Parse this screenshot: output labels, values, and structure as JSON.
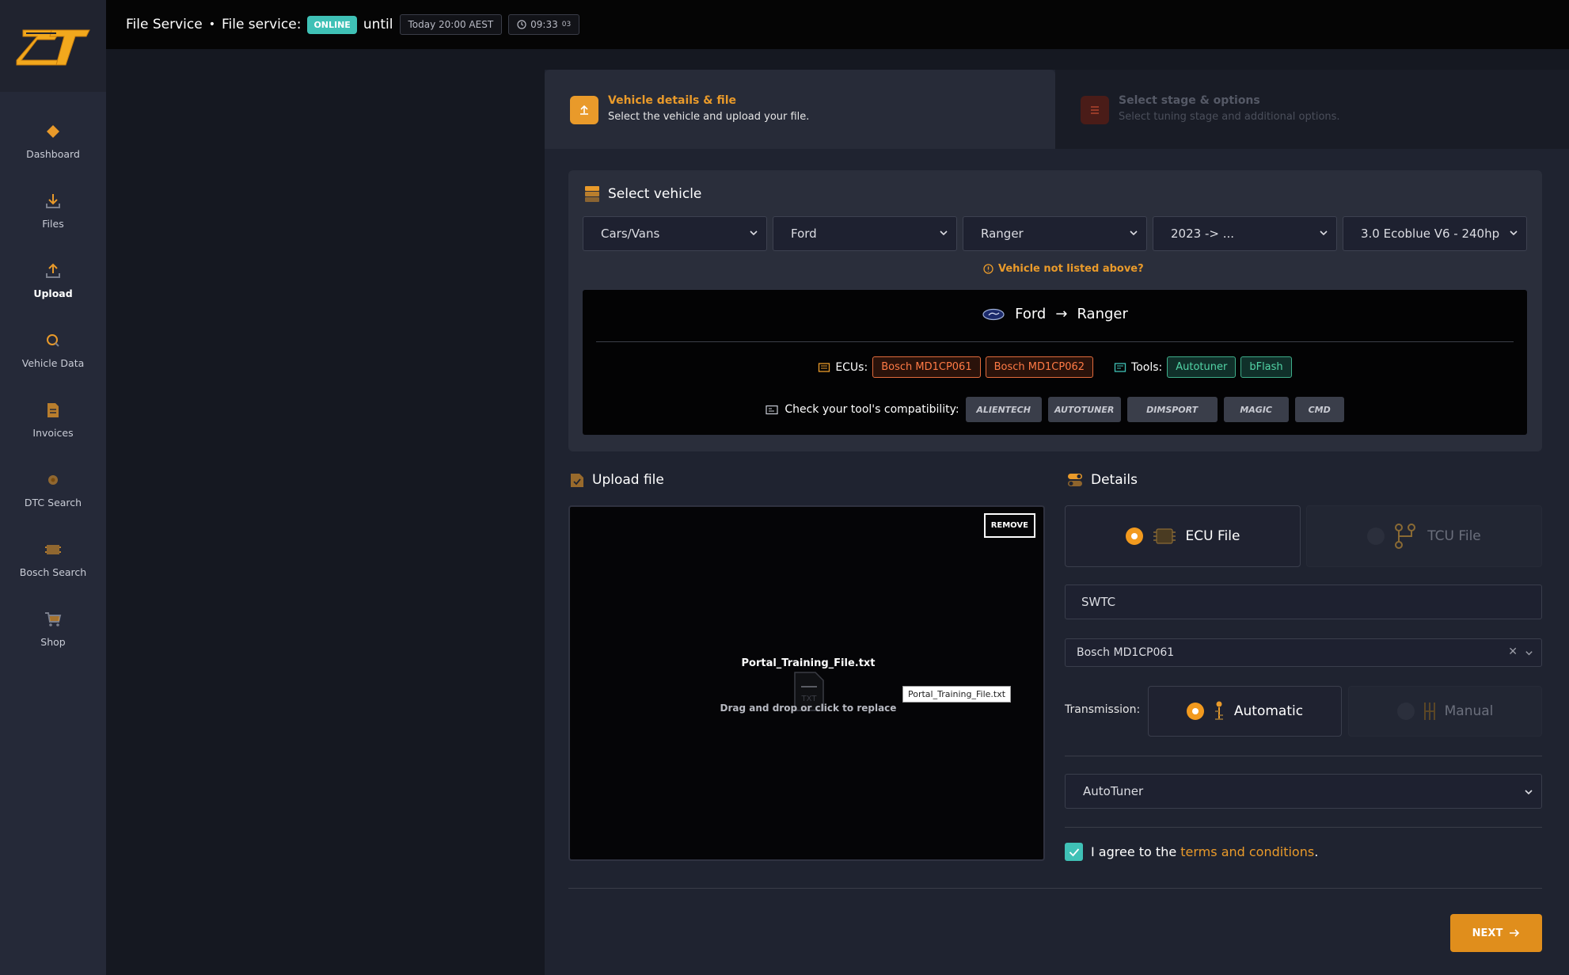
{
  "brand": {
    "logo_text": "ZT",
    "accent": "#e99a2a"
  },
  "topbar": {
    "title": "File Service",
    "separator": "•",
    "service_label": "File service:",
    "status": "ONLINE",
    "until": "until",
    "until_time": "Today 20:00 AEST",
    "clock": "09:33",
    "clock_seconds": "03"
  },
  "sidebar": {
    "items": [
      {
        "label": "Dashboard",
        "icon": "diamond-icon"
      },
      {
        "label": "Files",
        "icon": "download-icon"
      },
      {
        "label": "Upload",
        "icon": "upload-icon",
        "active": true
      },
      {
        "label": "Vehicle Data",
        "icon": "search-icon"
      },
      {
        "label": "Invoices",
        "icon": "document-icon"
      },
      {
        "label": "DTC Search",
        "icon": "engine-icon"
      },
      {
        "label": "Bosch Search",
        "icon": "chip-icon"
      },
      {
        "label": "Shop",
        "icon": "cart-icon"
      }
    ]
  },
  "steps": [
    {
      "title": "Vehicle details & file",
      "subtitle": "Select the vehicle and upload your file.",
      "active": true
    },
    {
      "title": "Select stage & options",
      "subtitle": "Select tuning stage and additional options.",
      "active": false
    }
  ],
  "select_vehicle": {
    "title": "Select vehicle",
    "category": "Cars/Vans",
    "make": "Ford",
    "model": "Ranger",
    "year": "2023 -> ...",
    "engine": "3.0 Ecoblue V6 - 240hp",
    "not_listed": "Vehicle not listed above?"
  },
  "vehicle_summary": {
    "make": "Ford",
    "arrow": "→",
    "model": "Ranger",
    "ecus_label": "ECUs:",
    "ecus": [
      "Bosch MD1CP061",
      "Bosch MD1CP062"
    ],
    "tools_label": "Tools:",
    "tools": [
      "Autotuner",
      "bFlash"
    ],
    "compat_label": "Check your tool's compatibility:",
    "compat_tools": [
      "ALIENTECH",
      "AUTOTUNER",
      "DIMSPORT",
      "MAGIC",
      "CMD"
    ]
  },
  "upload": {
    "title": "Upload file",
    "remove_label": "REMOVE",
    "file_name": "Portal_Training_File.txt",
    "file_ext": "TXT",
    "hint": "Drag and drop or click to replace",
    "tooltip": "Portal_Training_File.txt"
  },
  "details": {
    "title": "Details",
    "ecu_file": "ECU File",
    "tcu_file": "TCU File",
    "software_value": "SWTC",
    "ecu_value": "Bosch MD1CP061",
    "transmission_label": "Transmission:",
    "automatic": "Automatic",
    "manual": "Manual",
    "tool_value": "AutoTuner",
    "agree_prefix": "I agree to the",
    "terms": "terms and conditions",
    "agree_suffix": "."
  },
  "actions": {
    "next": "NEXT"
  }
}
